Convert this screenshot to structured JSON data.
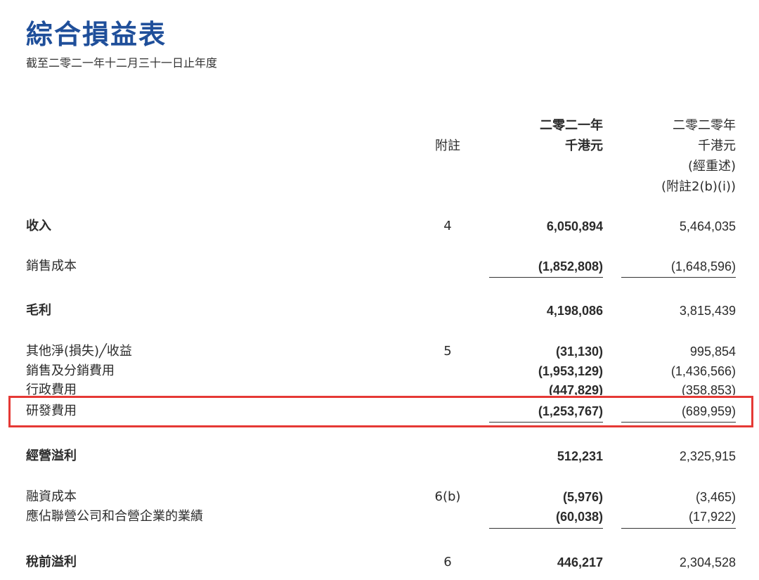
{
  "title": "綜合損益表",
  "subtitle": "截至二零二一年十二月三十一日止年度",
  "header": {
    "note_label": "附註",
    "current_year": "二零二一年",
    "current_unit": "千港元",
    "prior_year": "二零二零年",
    "prior_unit": "千港元",
    "prior_restated": "(經重述)",
    "prior_note_ref": "(附註2(b)(i))"
  },
  "rows": [
    {
      "label": "收入",
      "note": "4",
      "current": "6,050,894",
      "prior": "5,464,035",
      "bold": true
    },
    {
      "label": "銷售成本",
      "note": "",
      "current": "(1,852,808)",
      "prior": "(1,648,596)",
      "bold": false
    },
    {
      "label": "毛利",
      "note": "",
      "current": "4,198,086",
      "prior": "3,815,439",
      "bold": true
    },
    {
      "label": "其他淨(損失)╱收益",
      "note": "5",
      "current": "(31,130)",
      "prior": "995,854",
      "bold": false
    },
    {
      "label": "銷售及分銷費用",
      "note": "",
      "current": "(1,953,129)",
      "prior": "(1,436,566)",
      "bold": false
    },
    {
      "label": "行政費用",
      "note": "",
      "current": "(447,829)",
      "prior": "(358,853)",
      "bold": false
    },
    {
      "label": "研發費用",
      "note": "",
      "current": "(1,253,767)",
      "prior": "(689,959)",
      "bold": false
    },
    {
      "label": "經營溢利",
      "note": "",
      "current": "512,231",
      "prior": "2,325,915",
      "bold": true
    },
    {
      "label": "融資成本",
      "note": "6(b)",
      "current": "(5,976)",
      "prior": "(3,465)",
      "bold": false
    },
    {
      "label": "應佔聯營公司和合營企業的業績",
      "note": "",
      "current": "(60,038)",
      "prior": "(17,922)",
      "bold": false
    },
    {
      "label": "稅前溢利",
      "note": "6",
      "current": "446,217",
      "prior": "2,304,528",
      "bold": true
    }
  ],
  "colors": {
    "title": "#1f4f9a",
    "highlight_border": "#e53935",
    "text": "#2b2b2b"
  }
}
